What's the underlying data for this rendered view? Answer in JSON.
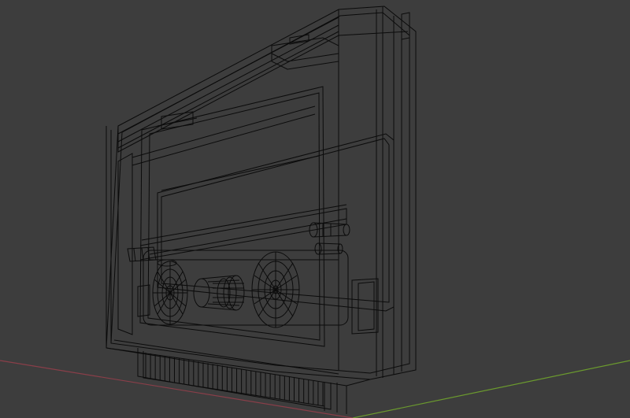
{
  "viewport": {
    "background": "#3d3d3d",
    "wire_color": "#0b0b0b",
    "x_axis_color": "#8a3e49",
    "y_axis_color": "#6b9a2e",
    "shading": "wireframe",
    "object": "cassette-tape"
  }
}
